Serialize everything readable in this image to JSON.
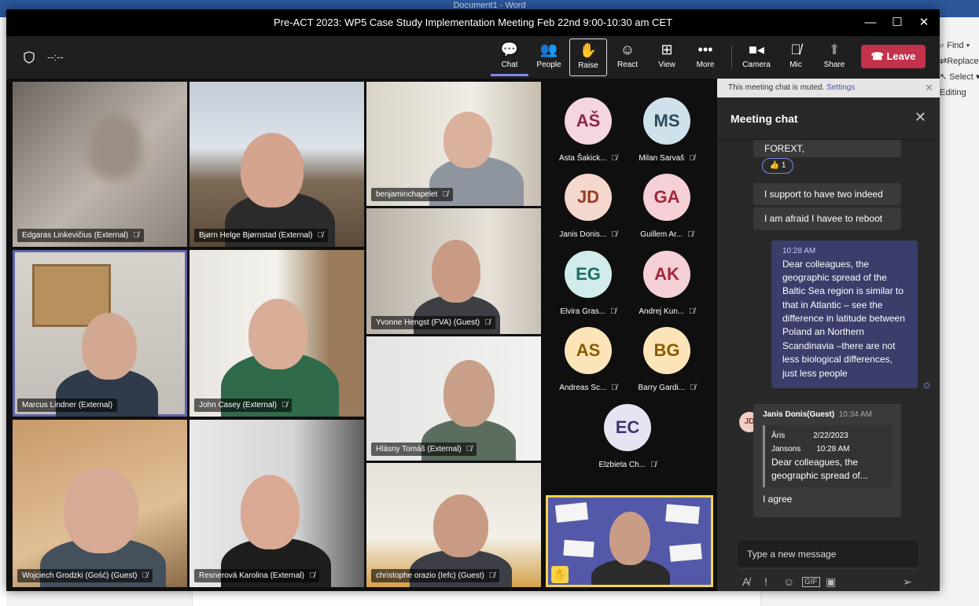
{
  "word": {
    "doc_title": "Document1 - Word",
    "find": "Find",
    "replace": "Replace",
    "select": "Select",
    "editing": "Editing"
  },
  "window": {
    "title": "Pre-ACT 2023: WP5 Case Study Implementation Meeting Feb 22nd 9:00-10:30 am CET",
    "timer": "--:--"
  },
  "toolbar": {
    "chat": "Chat",
    "people": "People",
    "raise": "Raise",
    "react": "React",
    "view": "View",
    "more": "More",
    "camera": "Camera",
    "mic": "Mic",
    "share": "Share",
    "leave": "Leave"
  },
  "videos": [
    {
      "name": "Edgaras Linkevičius (External)"
    },
    {
      "name": "Bjørn Helge Bjørnstad (External)"
    },
    {
      "name": "benjaminchapelet"
    },
    {
      "name": "Yvonne Hengst (FVA) (Guest)"
    },
    {
      "name": "Marcus Lindner (External)"
    },
    {
      "name": "John Casey (External)"
    },
    {
      "name": "Hlásny Tomáš (External)"
    },
    {
      "name": "Wojciech Grodzki (Gość) (Guest)"
    },
    {
      "name": "Resnerová Karolina (External)"
    },
    {
      "name": "christophe orazio (Iefc) (Guest)"
    }
  ],
  "audio_participants": [
    {
      "initials": "AŠ",
      "name": "Asta Šakick...",
      "bg": "#f3d6de",
      "fg": "#8a2a47"
    },
    {
      "initials": "MS",
      "name": "Milan Sarvaš",
      "bg": "#cfe2ec",
      "fg": "#2f4a5a"
    },
    {
      "initials": "JD",
      "name": "Janis Donis...",
      "bg": "#f4d7cd",
      "fg": "#9a3b24"
    },
    {
      "initials": "GA",
      "name": "Guillem Ar...",
      "bg": "#f5d0d6",
      "fg": "#a2263c"
    },
    {
      "initials": "EG",
      "name": "Elvira Gras...",
      "bg": "#d1ecea",
      "fg": "#1e6b64"
    },
    {
      "initials": "AK",
      "name": "Andrej Kun...",
      "bg": "#f5d0d6",
      "fg": "#a2263c"
    },
    {
      "initials": "AS",
      "name": "Andreas Sc...",
      "bg": "#fbe5b8",
      "fg": "#8a5a00"
    },
    {
      "initials": "BG",
      "name": "Barry Gardi...",
      "bg": "#fbe5b8",
      "fg": "#8a5a00"
    },
    {
      "initials": "EC",
      "name": "Elzbieta Ch...",
      "bg": "#e6e4f2",
      "fg": "#3b3673"
    }
  ],
  "chat": {
    "muted_notice": "This meeting chat is muted.",
    "settings_link": "Settings",
    "title": "Meeting chat",
    "msg_forext": "FOREXT,",
    "reaction_count": "1",
    "msg_support": "I support to have two indeed",
    "msg_reboot": "I am afraid I havee to reboot",
    "my_time": "10:28 AM",
    "my_message": "Dear colleagues, the geographic spread of the Baltic Sea region is similar to that in Atlantic – see the difference in latitude between Poland an Northern Scandinavia –there are not less biological differences, just less people",
    "reply_initials": "JD",
    "reply_sender": "Janis Donis(Guest)",
    "reply_time": "10:34 AM",
    "quote_author_1": "Āris",
    "quote_author_2": "Jansons",
    "quote_date": "2/22/2023",
    "quote_time": "10:28 AM",
    "quote_text": "Dear colleagues, the geographic spread of...",
    "reply_text": "I agree",
    "compose_placeholder": "Type a new message"
  },
  "colors": {
    "accent": "#6264a7",
    "leave": "#c4314b",
    "self_border": "#f6d34b"
  }
}
